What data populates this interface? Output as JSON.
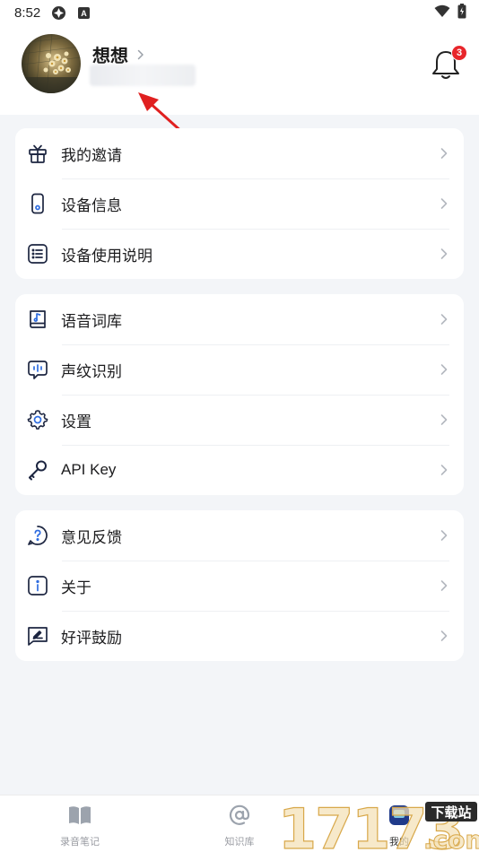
{
  "status_bar": {
    "time": "8:52"
  },
  "profile": {
    "username": "想想",
    "notification_count": "3"
  },
  "menu_groups": [
    {
      "items": [
        {
          "label": "我的邀请",
          "icon": "gift-icon"
        },
        {
          "label": "设备信息",
          "icon": "device-icon"
        },
        {
          "label": "设备使用说明",
          "icon": "list-icon"
        }
      ]
    },
    {
      "items": [
        {
          "label": "语音词库",
          "icon": "music-book-icon"
        },
        {
          "label": "声纹识别",
          "icon": "voiceprint-icon"
        },
        {
          "label": "设置",
          "icon": "gear-icon"
        },
        {
          "label": "API Key",
          "icon": "key-icon"
        }
      ]
    },
    {
      "items": [
        {
          "label": "意见反馈",
          "icon": "question-icon"
        },
        {
          "label": "关于",
          "icon": "info-icon"
        },
        {
          "label": "好评鼓励",
          "icon": "review-icon"
        }
      ]
    }
  ],
  "tabbar": {
    "tabs": [
      {
        "label": "录音笔记",
        "icon": "book-icon"
      },
      {
        "label": "知识库",
        "icon": "at-icon"
      },
      {
        "label": "我的",
        "icon": "profile-icon"
      }
    ]
  },
  "watermark": {
    "number": "17173",
    "tag": "下载站",
    "domain": ".com"
  },
  "colors": {
    "accent": "#1f3a8a",
    "badge": "#e8262b",
    "arrow": "#e02020"
  }
}
